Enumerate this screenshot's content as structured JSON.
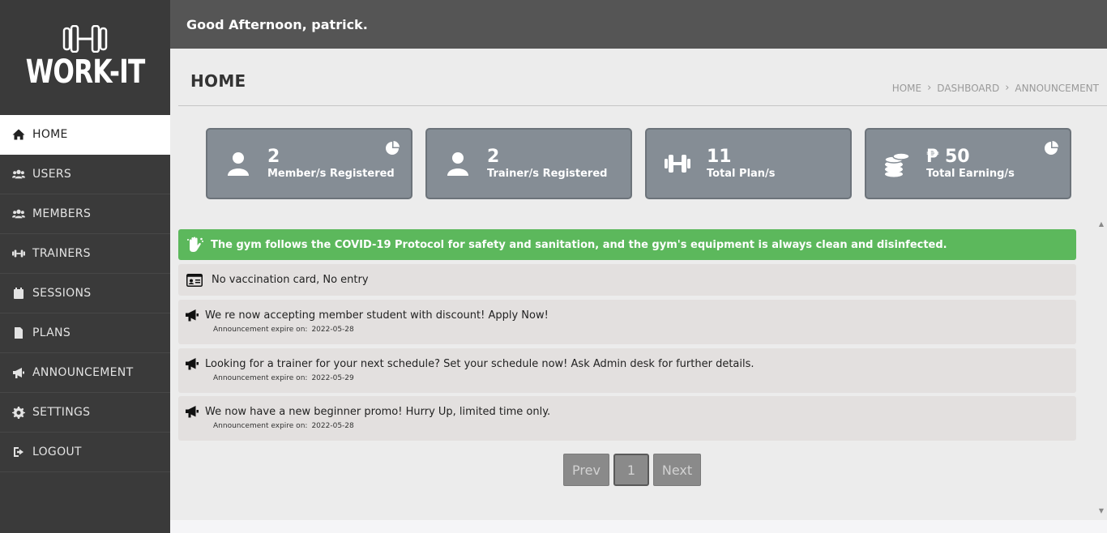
{
  "brand": {
    "name": "WORK-IT",
    "logo_icon": "dumbbell-icon"
  },
  "sidebar": {
    "items": [
      {
        "label": "HOME",
        "icon": "home-icon",
        "active": true
      },
      {
        "label": "USERS",
        "icon": "users-icon"
      },
      {
        "label": "MEMBERS",
        "icon": "users-icon"
      },
      {
        "label": "TRAINERS",
        "icon": "dumbbell-icon"
      },
      {
        "label": "SESSIONS",
        "icon": "calendar-icon"
      },
      {
        "label": "PLANS",
        "icon": "file-icon"
      },
      {
        "label": "ANNOUNCEMENT",
        "icon": "megaphone-icon"
      },
      {
        "label": "SETTINGS",
        "icon": "gear-icon"
      },
      {
        "label": "LOGOUT",
        "icon": "sign-out-icon"
      }
    ]
  },
  "header": {
    "greeting": "Good Afternoon, patrick."
  },
  "page": {
    "title": "HOME",
    "breadcrumb": [
      "HOME",
      "DASHBOARD",
      "ANNOUNCEMENT"
    ]
  },
  "stats": [
    {
      "value": "2",
      "label": "Member/s Registered",
      "icon": "user-icon",
      "pie": true
    },
    {
      "value": "2",
      "label": "Trainer/s Registered",
      "icon": "user-icon",
      "pie": false
    },
    {
      "value": "11",
      "label": "Total Plan/s",
      "icon": "dumbbell-icon",
      "pie": false
    },
    {
      "value": "₱ 50",
      "label": "Total Earning/s",
      "icon": "coins-icon",
      "pie": true
    }
  ],
  "notice": {
    "text": "The gym follows the COVID-19 Protocol for safety and sanitation, and the gym's equipment is always clean and disinfected.",
    "icon": "hands-wash-icon"
  },
  "rule": {
    "text": "No vaccination card, No entry",
    "icon": "id-card-icon"
  },
  "announcements": [
    {
      "text": "We re now accepting member student with discount! Apply Now!",
      "expire_label": "Announcement expire on:",
      "expire_date": "2022-05-28"
    },
    {
      "text": "Looking for a trainer for your next schedule? Set your schedule now! Ask Admin desk for further details.",
      "expire_label": "Announcement expire on:",
      "expire_date": "2022-05-29"
    },
    {
      "text": "We now have a new beginner promo! Hurry Up, limited time only.",
      "expire_label": "Announcement expire on:",
      "expire_date": "2022-05-28"
    }
  ],
  "pagination": {
    "prev": "Prev",
    "current": "1",
    "next": "Next"
  },
  "colors": {
    "sidebar": "#3a3a3a",
    "header": "#555555",
    "card": "#858d95",
    "notice": "#5cb85c",
    "row": "#e3e0df"
  }
}
